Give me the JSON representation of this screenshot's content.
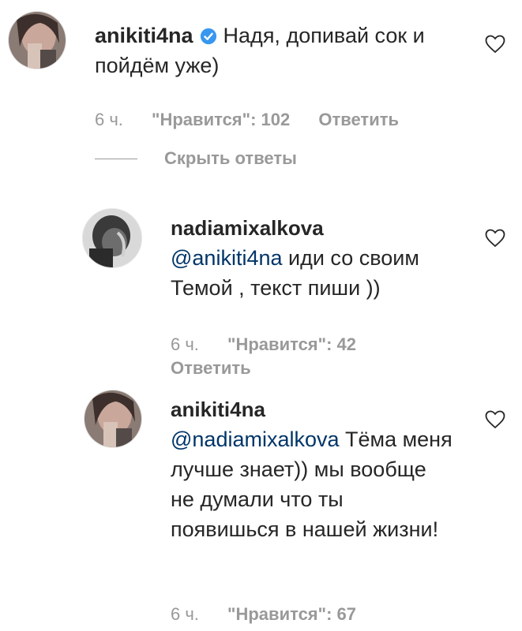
{
  "comments": [
    {
      "username": "anikiti4na",
      "verified": true,
      "text": "Надя, допивай сок и пойдём уже)",
      "time": "6 ч.",
      "likes": "\"Нравится\": 102",
      "reply": "Ответить"
    }
  ],
  "hide_replies": "Скрыть ответы",
  "replies": [
    {
      "username": "nadiamixalkova",
      "mention": "@anikiti4na",
      "text": " иди со своим Темой , текст пиши ))",
      "time": "6 ч.",
      "likes": "\"Нравится\": 42",
      "reply": "Ответить"
    },
    {
      "username": "anikiti4na",
      "mention": "@nadiamixalkova",
      "text": " Тёма меня лучше знает)) мы вообще не думали что ты появишься в нашей жизни!",
      "time": "6 ч.",
      "likes": "\"Нравится\": 67"
    }
  ],
  "colors": {
    "text": "#262626",
    "meta": "#999999",
    "mention": "#003569",
    "verified": "#3897f0"
  },
  "icons": {
    "like": "heart-outline-icon",
    "verified": "verified-badge-icon"
  }
}
